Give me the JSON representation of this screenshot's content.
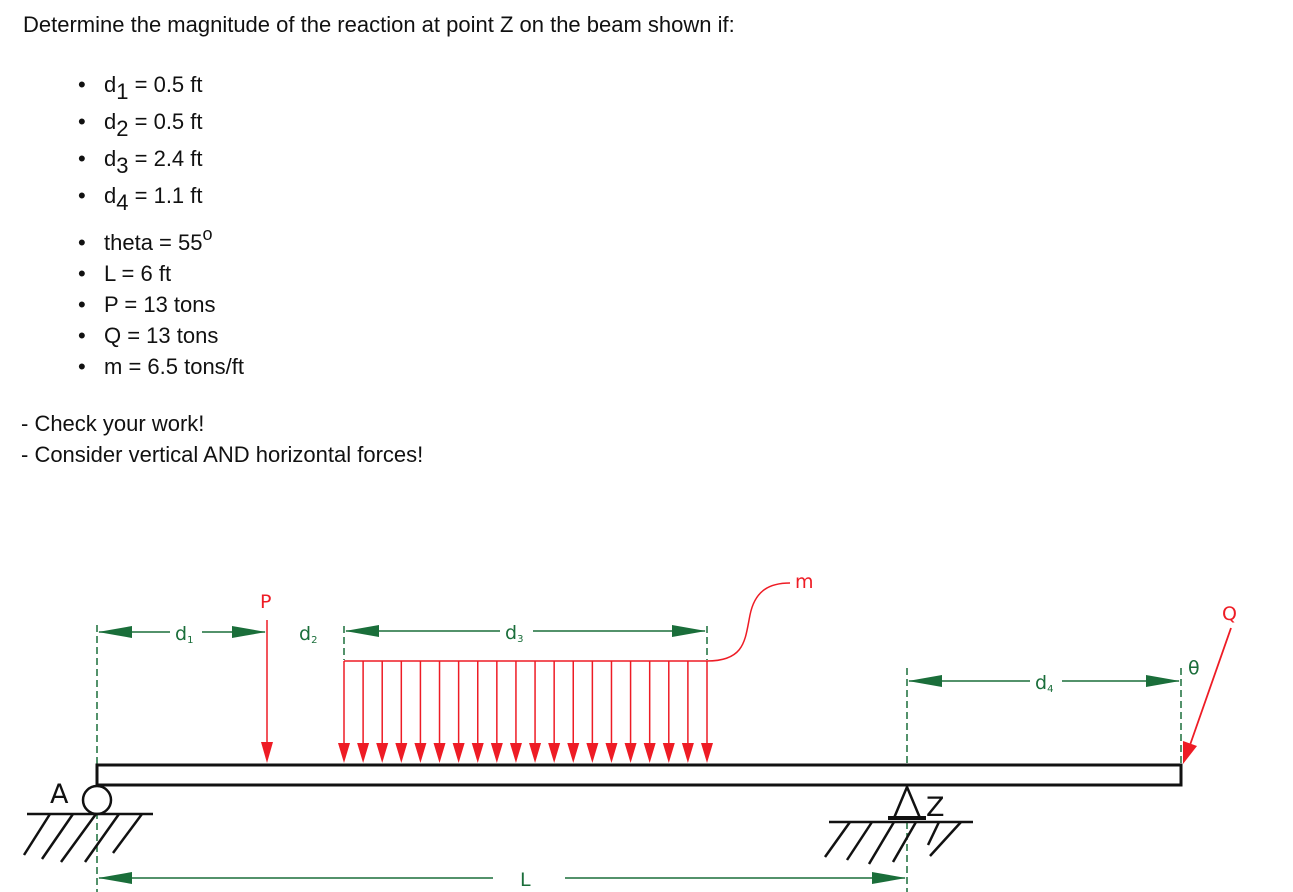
{
  "question": "Determine the magnitude of the reaction at point Z on the beam shown if:",
  "parameters_group1": [
    {
      "symbol": "d",
      "subscript": "1",
      "value": "= 0.5 ft"
    },
    {
      "symbol": "d",
      "subscript": "2",
      "value": "= 0.5 ft"
    },
    {
      "symbol": "d",
      "subscript": "3",
      "value": "= 2.4 ft"
    },
    {
      "symbol": "d",
      "subscript": "4",
      "value": "= 1.1 ft"
    }
  ],
  "parameters_group2": [
    {
      "text": "theta = 55",
      "superscript": "o"
    },
    {
      "text": "L = 6 ft"
    },
    {
      "text": "P = 13 tons"
    },
    {
      "text": "Q = 13 tons"
    },
    {
      "text": "m = 6.5 tons/ft"
    }
  ],
  "notes": [
    "- Check your work!",
    "- Consider vertical AND horizontal forces!"
  ],
  "diagram": {
    "labels": {
      "support_left": "A",
      "support_right": "Z",
      "point_load": "P",
      "inclined_load": "Q",
      "distributed_load": "m",
      "angle": "θ",
      "span": "L",
      "d1": {
        "base": "d",
        "sub": "1"
      },
      "d2": {
        "base": "d",
        "sub": "2"
      },
      "d3": {
        "base": "d",
        "sub": "3"
      },
      "d4": {
        "base": "d",
        "sub": "4"
      }
    },
    "udl_arrow_count": 20,
    "colors": {
      "load": "#ee1c25",
      "dimension": "#1a6e3a",
      "structure": "#111111"
    }
  }
}
